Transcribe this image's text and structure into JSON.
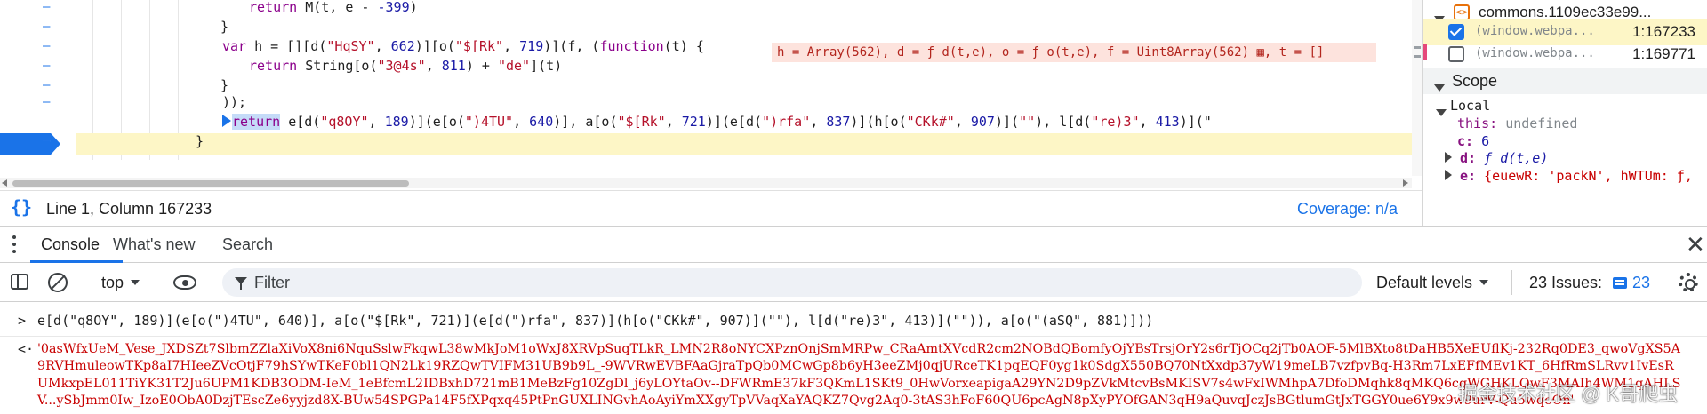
{
  "editor": {
    "lines": [
      {
        "parts": [
          [
            "kw",
            "return "
          ],
          [
            "plain",
            "M(t, e - "
          ],
          [
            "num",
            "-399"
          ],
          [
            "plain",
            ")"
          ]
        ]
      },
      {
        "parts": [
          [
            "plain",
            "}"
          ]
        ]
      },
      {
        "parts": [
          [
            "kw",
            "var "
          ],
          [
            "plain",
            "h = [][d("
          ],
          [
            "str",
            "\"HqSY\""
          ],
          [
            "plain",
            ", "
          ],
          [
            "num",
            "662"
          ],
          [
            "plain",
            ")][o("
          ],
          [
            "str",
            "\"$[Rk\""
          ],
          [
            "plain",
            ", "
          ],
          [
            "num",
            "719"
          ],
          [
            "plain",
            ")](f, ("
          ],
          [
            "kw",
            "function"
          ],
          [
            "plain",
            "(t) {"
          ]
        ]
      },
      {
        "parts": [
          [
            "kw",
            "return "
          ],
          [
            "plain",
            "String[o("
          ],
          [
            "str",
            "\"3@4s\""
          ],
          [
            "plain",
            ", "
          ],
          [
            "num",
            "811"
          ],
          [
            "plain",
            ") + "
          ],
          [
            "str",
            "\"de\""
          ],
          [
            "plain",
            "](t)"
          ]
        ]
      },
      {
        "parts": [
          [
            "plain",
            "}"
          ]
        ]
      },
      {
        "parts": [
          [
            "plain",
            "));"
          ]
        ]
      },
      {
        "parts": [
          [
            "plain",
            "e[d("
          ],
          [
            "str",
            "\"q8OY\""
          ],
          [
            "plain",
            ", "
          ],
          [
            "num",
            "189"
          ],
          [
            "plain",
            ")](e[o("
          ],
          [
            "str",
            "\")4TU\""
          ],
          [
            "plain",
            ", "
          ],
          [
            "num",
            "640"
          ],
          [
            "plain",
            ")], a[o("
          ],
          [
            "str",
            "\"$[Rk\""
          ],
          [
            "plain",
            ", "
          ],
          [
            "num",
            "721"
          ],
          [
            "plain",
            ")](e[d("
          ],
          [
            "str",
            "\")rfa\""
          ],
          [
            "plain",
            ", "
          ],
          [
            "num",
            "837"
          ],
          [
            "plain",
            ")](h[o("
          ],
          [
            "str",
            "\"CKk#\""
          ],
          [
            "plain",
            ", "
          ],
          [
            "num",
            "907"
          ],
          [
            "plain",
            ")]("
          ],
          [
            "str",
            "\"\""
          ],
          [
            "plain",
            "), l[d("
          ],
          [
            "str",
            "\"re)3\""
          ],
          [
            "plain",
            ", "
          ],
          [
            "num",
            "413"
          ],
          [
            "plain",
            ")](\""
          ]
        ]
      },
      {
        "parts": [
          [
            "plain",
            "}"
          ]
        ]
      }
    ],
    "exec_return_keyword": "return",
    "inline_value": "h = Array(562), d = ƒ d(t,e), o = ƒ o(t,e), f = Uint8Array(562) ▦, t = []"
  },
  "status": {
    "position": "Line 1, Column 167233",
    "coverage": "Coverage: n/a"
  },
  "sidebar": {
    "file_name": "commons.1109ec33e99...",
    "breakpoints": [
      {
        "text": "(window.webpa...",
        "location": "1:167233",
        "checked": true
      },
      {
        "text": "(window.webpa...",
        "location": "1:169771",
        "checked": false
      }
    ],
    "scope_title": "Scope",
    "local_title": "Local",
    "vars": [
      {
        "name": "this:",
        "value": "undefined"
      },
      {
        "name": "c:",
        "value": "6"
      },
      {
        "name": "d:",
        "value": "ƒ d(t,e)"
      },
      {
        "name": "e:",
        "value": "{euewR: 'packN', hWTUm: ƒ,"
      }
    ]
  },
  "drawer": {
    "tabs": [
      "Console",
      "What's new",
      "Search"
    ],
    "active_tab": "Console",
    "close_glyph": "✕"
  },
  "toolbar": {
    "context": "top",
    "filter_placeholder": "Filter",
    "levels": "Default levels",
    "issues_label": "23 Issues:",
    "issues_count": "23"
  },
  "console": {
    "command": "e[d(\"q8OY\", 189)](e[o(\")4TU\", 640)], a[o(\"$[Rk\", 721)](e[d(\")rfa\", 837)](h[o(\"CKk#\", 907)](\"\"), l[d(\"re)3\", 413)](\"\")), a[o(\"(aSQ\", 881)]))",
    "result": "'0asWfxUeM_Vese_JXDSZt7SlbmZZlaXiVoX8ni6NquSslwFkqwL38wMkJoM1oWxJ8XRVpSuqTLkR_LMN2R8oNYCXPznOnjSmMRPw_CRaAmtXVcdR2cm2NOBdQBomfyOjYBsTrsjOrY2s6rTjOCq2jTb0AOF-5MlBXto8tDaHB5XeEUflKj-232Rq0DE3_qwoVgXS5A9RVHmuleowTKp8aI7HIeeZVcOtjF79hSYwTKeF0bl1QN2Lk19RZQwTVIFM31UB9b9L_-9WVRwEVBFAaGjraTpQb0MCwGp8b6yH3eeZMj0qjURceTK1pqEQF0yg1k0SdgX550BQ70NtXxdp37yW19meLB7vzfpvBq-H3Rm7LxEFfMEv1KT_6HfRmSLRvv1IvEsRUMkxpEL011TiYK31T2Ju6UPM1KDB3ODM-IeM_1eBfcmL2IDBxhD721mB1MeBzFg10ZgDl_j6yLOYtaOv--DFWRmE37kF3QKmL1SKt9_0HwVorxeapigaA29YN2D9pZVkMtcvBsMKISV7s4wFxIWMhpA7DfoDMqhk8qMKQ6cgWGHKLQwF3MAIh4WM1qAHLSV...ySbJmm0Iw_IzoE0ObA0DzjTEscZe6yyjzd8X-BUw54SPGPa14F5fXPqxq45PtPnGUXLINGvhAoAyiYmXXgyTpVVaqXaYAQKZ7Qvg2Aq0-3tAS3hFoF60QU6pcAgN8pXyPYOfGAN3qH9aQuvqJczJsBGtlumGtJxTGGY0ue6Y9x9w9urV-Qu5wqeOn'",
    "watermark": "掘金技术社区 @ K哥爬虫"
  }
}
